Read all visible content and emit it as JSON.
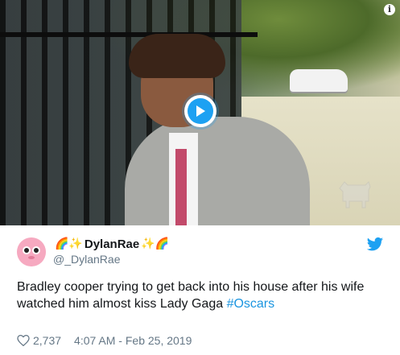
{
  "video": {
    "play_icon": "play-icon",
    "info_icon_glyph": "i",
    "watermark_icon": "donkey-icon"
  },
  "user": {
    "display_name": "DylanRae",
    "name_prefix_emoji": "🌈✨",
    "name_suffix_emoji": "✨🌈",
    "handle": "@_DylanRae",
    "avatar_icon": "avatar-icon"
  },
  "tweet": {
    "text": "Bradley cooper trying to get back into his house after his wife watched him almost kiss Lady Gaga ",
    "hashtag": "#Oscars",
    "likes": "2,737",
    "timestamp": "4:07 AM - Feb 25, 2019"
  },
  "brand": {
    "icon": "twitter-bird-icon",
    "color": "#1da1f2",
    "link_color": "#1b95e0",
    "muted_color": "#657786"
  }
}
